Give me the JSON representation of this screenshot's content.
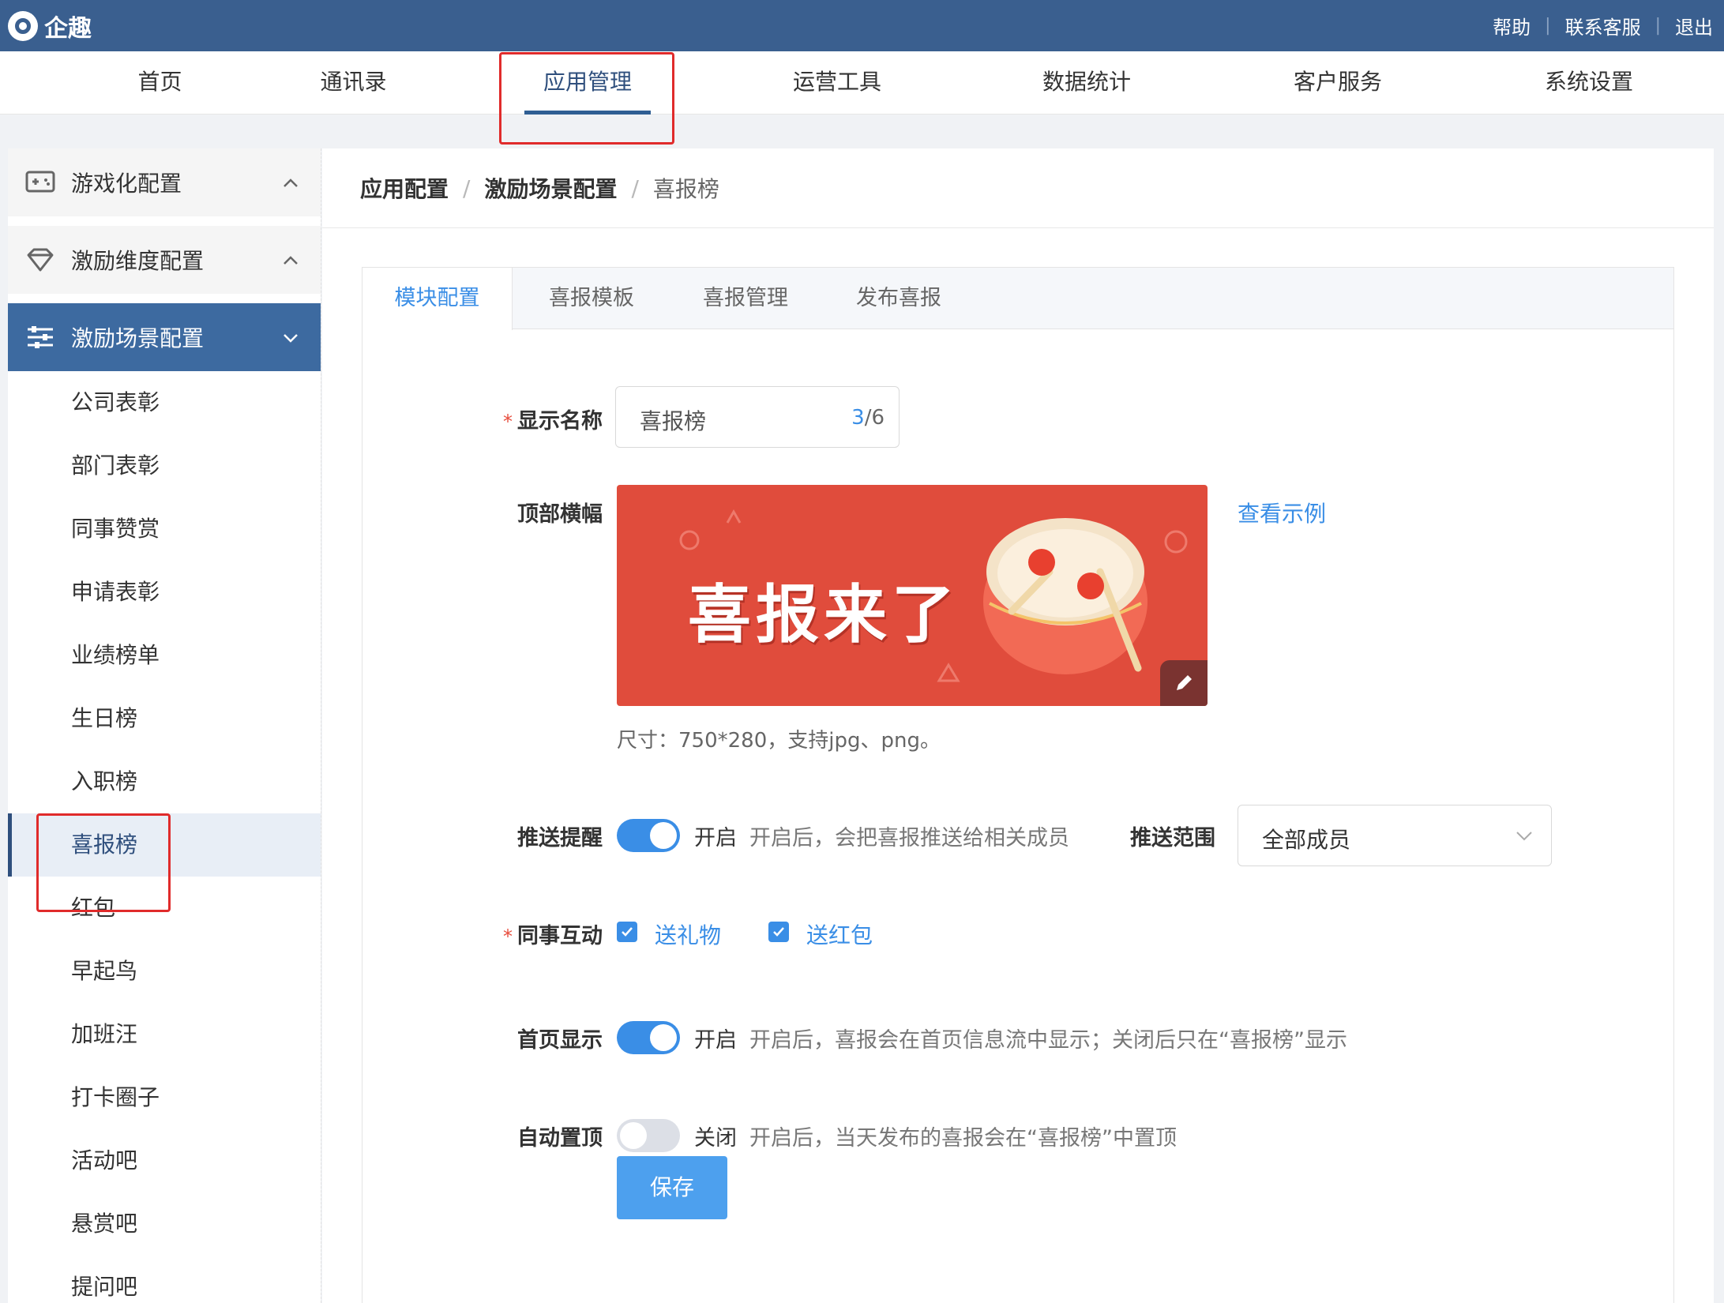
{
  "app": {
    "name": "企趣"
  },
  "top_links": [
    "帮助",
    "联系客服",
    "退出"
  ],
  "nav": [
    "首页",
    "通讯录",
    "应用管理",
    "运营工具",
    "数据统计",
    "客户服务",
    "系统设置"
  ],
  "sidebar": {
    "groups": [
      {
        "label": "游戏化配置",
        "icon": "gamepad-icon"
      },
      {
        "label": "激励维度配置",
        "icon": "diamond-icon"
      },
      {
        "label": "激励场景配置",
        "icon": "sliders-icon"
      }
    ],
    "items": [
      "公司表彰",
      "部门表彰",
      "同事赞赏",
      "申请表彰",
      "业绩榜单",
      "生日榜",
      "入职榜",
      "喜报榜",
      "红包",
      "早起鸟",
      "加班汪",
      "打卡圈子",
      "活动吧",
      "悬赏吧",
      "提问吧"
    ],
    "active_item": "喜报榜"
  },
  "breadcrumb": [
    "应用配置",
    "激励场景配置",
    "喜报榜"
  ],
  "tabs": [
    "模块配置",
    "喜报模板",
    "喜报管理",
    "发布喜报"
  ],
  "form": {
    "display_name": {
      "label": "显示名称",
      "value": "喜报榜",
      "count": "3",
      "max": "/6"
    },
    "banner": {
      "label": "顶部横幅",
      "title": "喜报来了",
      "example_link": "查看示例",
      "size_hint": "尺寸：750*280，支持jpg、png。"
    },
    "push": {
      "label": "推送提醒",
      "state": "开启",
      "desc": "开启后，会把喜报推送给相关成员",
      "range_label": "推送范围",
      "range_value": "全部成员"
    },
    "interaction": {
      "label": "同事互动",
      "opt1": "送礼物",
      "opt2": "送红包"
    },
    "home": {
      "label": "首页显示",
      "state": "开启",
      "desc": "开启后，喜报会在首页信息流中显示；关闭后只在“喜报榜”显示"
    },
    "pin": {
      "label": "自动置顶",
      "state": "关闭",
      "desc": "开启后，当天发布的喜报会在“喜报榜”中置顶"
    },
    "save": "保存"
  },
  "colors": {
    "topbar": "#3a5f8f",
    "accent": "#3a8ee6",
    "banner": "#e04c3c",
    "highlight": "#e02b2b"
  }
}
